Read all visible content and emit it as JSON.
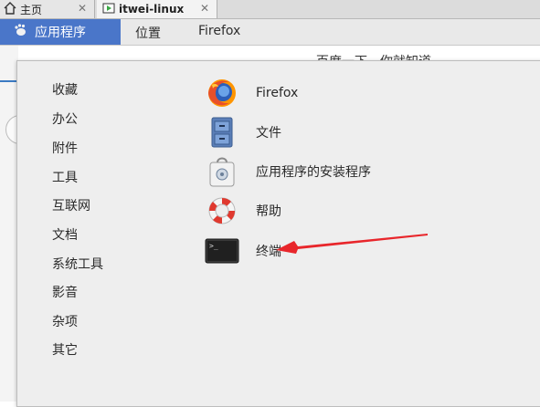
{
  "tabs": [
    {
      "label": "主页",
      "close": "✕"
    },
    {
      "label": "itwei-linux",
      "close": "✕"
    }
  ],
  "topbar": {
    "apps_menu": "应用程序",
    "places_menu": "位置",
    "firefox_menu": "Firefox"
  },
  "background": {
    "partial_text": "百度一下，你就知道"
  },
  "categories": [
    "收藏",
    "办公",
    "附件",
    "工具",
    "互联网",
    "文档",
    "系统工具",
    "影音",
    "杂项",
    "其它"
  ],
  "apps": [
    {
      "label": "Firefox",
      "icon": "firefox-icon"
    },
    {
      "label": "文件",
      "icon": "file-manager-icon"
    },
    {
      "label": "应用程序的安装程序",
      "icon": "software-install-icon"
    },
    {
      "label": "帮助",
      "icon": "help-lifebuoy-icon"
    },
    {
      "label": "终端",
      "icon": "terminal-icon"
    }
  ],
  "colors": {
    "apps_menu_bg": "#4a76c9",
    "annotation_arrow": "#e8262b"
  }
}
